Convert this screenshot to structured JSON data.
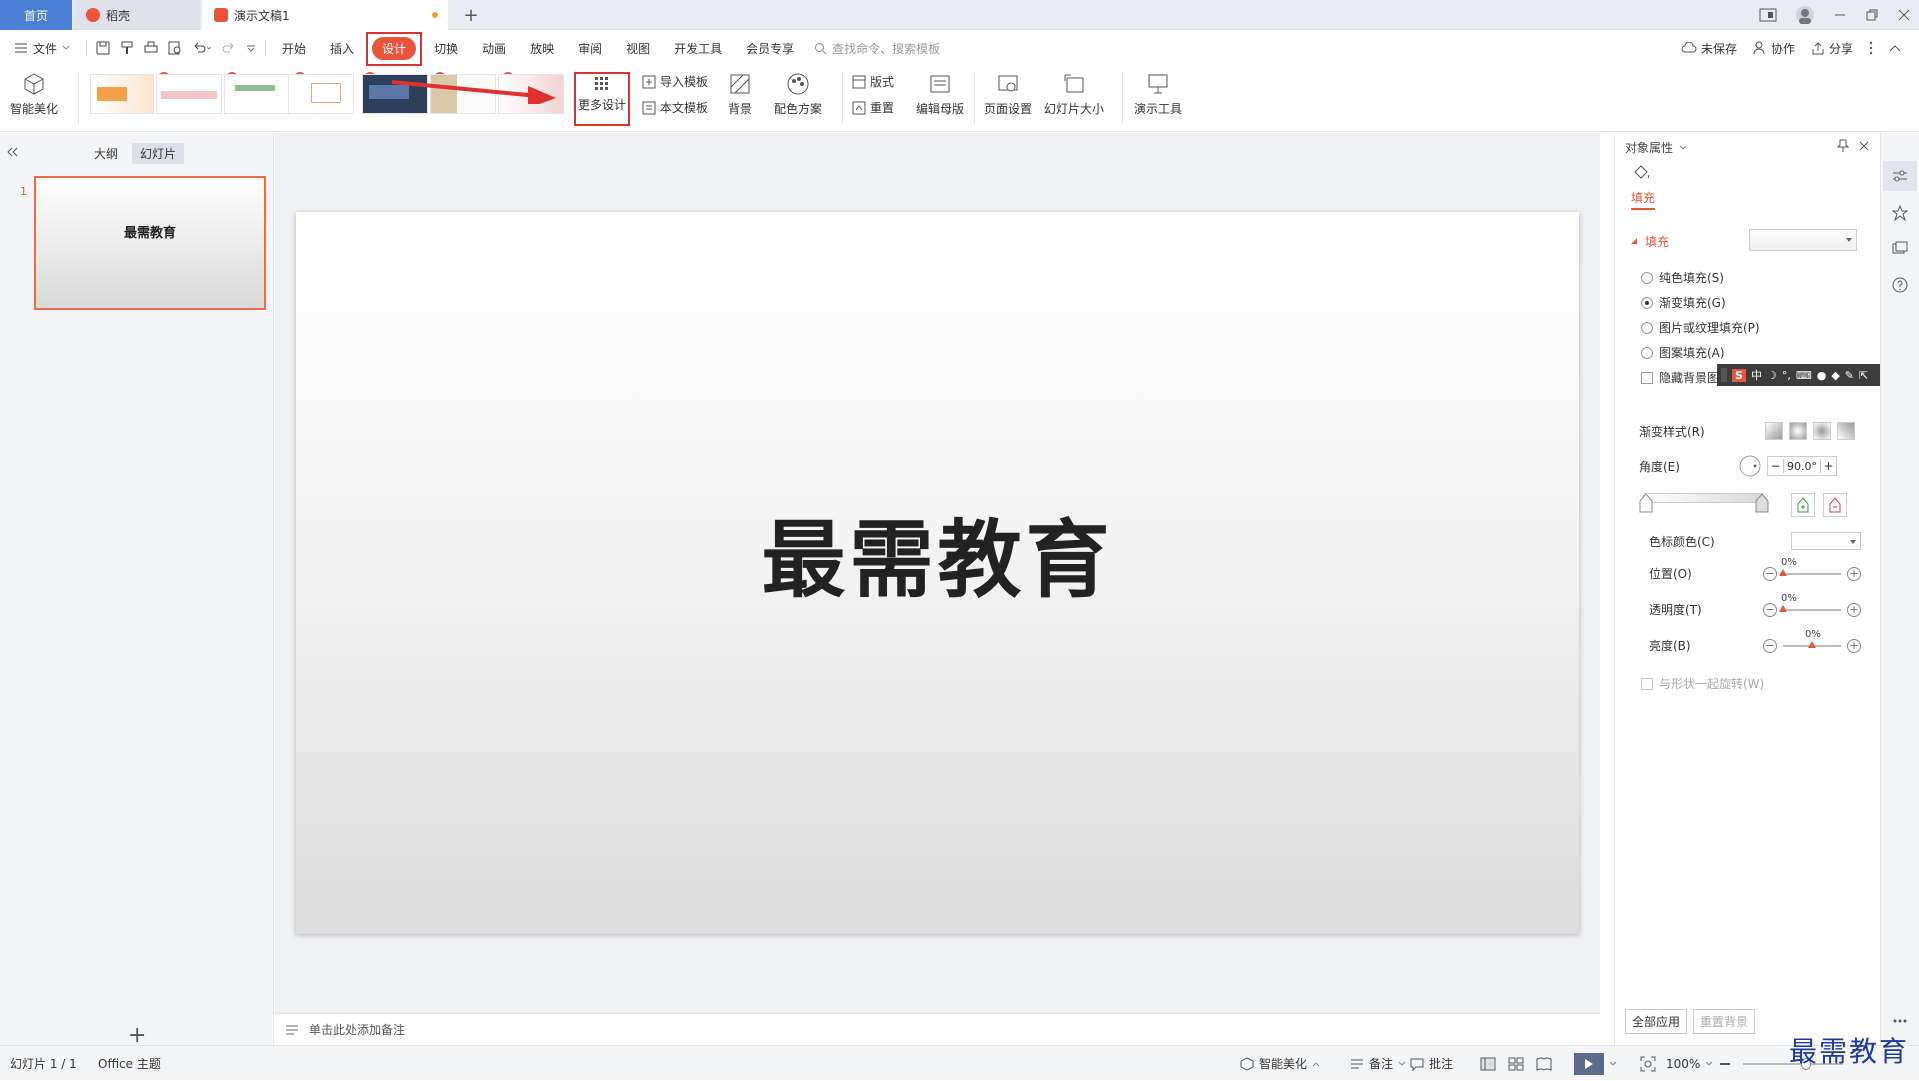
{
  "titlebar": {
    "tabs": [
      "首页",
      "稻壳",
      "演示文稿1"
    ],
    "add_tab": "+"
  },
  "menu": {
    "file": "文件",
    "tabs": [
      "开始",
      "插入",
      "设计",
      "切换",
      "动画",
      "放映",
      "审阅",
      "视图",
      "开发工具",
      "会员专享"
    ],
    "active_tab": "设计",
    "search_placeholder": "查找命令、搜索模板",
    "right": {
      "save": "未保存",
      "collab": "协作",
      "share": "分享"
    }
  },
  "ribbon": {
    "smart": "智能美化",
    "more_design": "更多设计",
    "import_template": "导入模板",
    "this_template": "本文模板",
    "background": "背景",
    "color_scheme": "配色方案",
    "layout": "版式",
    "reset": "重置",
    "edit_master": "编辑母版",
    "page_setup": "页面设置",
    "slide_size": "幻灯片大小",
    "present_tools": "演示工具"
  },
  "left_panel": {
    "tab_outline": "大纲",
    "tab_slides": "幻灯片",
    "slide_number": "1",
    "thumb_title": "最需教育",
    "add": "+"
  },
  "slide": {
    "title": "最需教育"
  },
  "notes": {
    "placeholder": "单击此处添加备注"
  },
  "right_panel": {
    "header": "对象属性",
    "fill_tab": "填充",
    "section_fill": "填充",
    "options": [
      "纯色填充(S)",
      "渐变填充(G)",
      "图片或纹理填充(P)",
      "图案填充(A)"
    ],
    "selected_option": "渐变填充(G)",
    "hide_bg": "隐藏背景图",
    "gradient_style": "渐变样式(R)",
    "angle_label": "角度(E)",
    "angle_value": "90.0°",
    "stop_color": "色标颜色(C)",
    "position_label": "位置(O)",
    "position_value": "0%",
    "transparency_label": "透明度(T)",
    "transparency_value": "0%",
    "brightness_label": "亮度(B)",
    "brightness_value": "0%",
    "rotate_with_shape": "与形状一起旋转(W)",
    "apply_all": "全部应用",
    "reset_bg": "重置背景"
  },
  "ime": {
    "logo": "S",
    "lang": "中"
  },
  "statusbar": {
    "slide_info": "幻灯片 1 / 1",
    "theme": "Office 主题",
    "smart": "智能美化",
    "notes": "备注",
    "comments": "批注",
    "zoom": "100%"
  },
  "watermark": "最需教育",
  "colors": {
    "accent": "#e8553a",
    "highlight": "#e03030",
    "home_tab": "#4a7fd6",
    "watermark": "#1f3a9a"
  }
}
